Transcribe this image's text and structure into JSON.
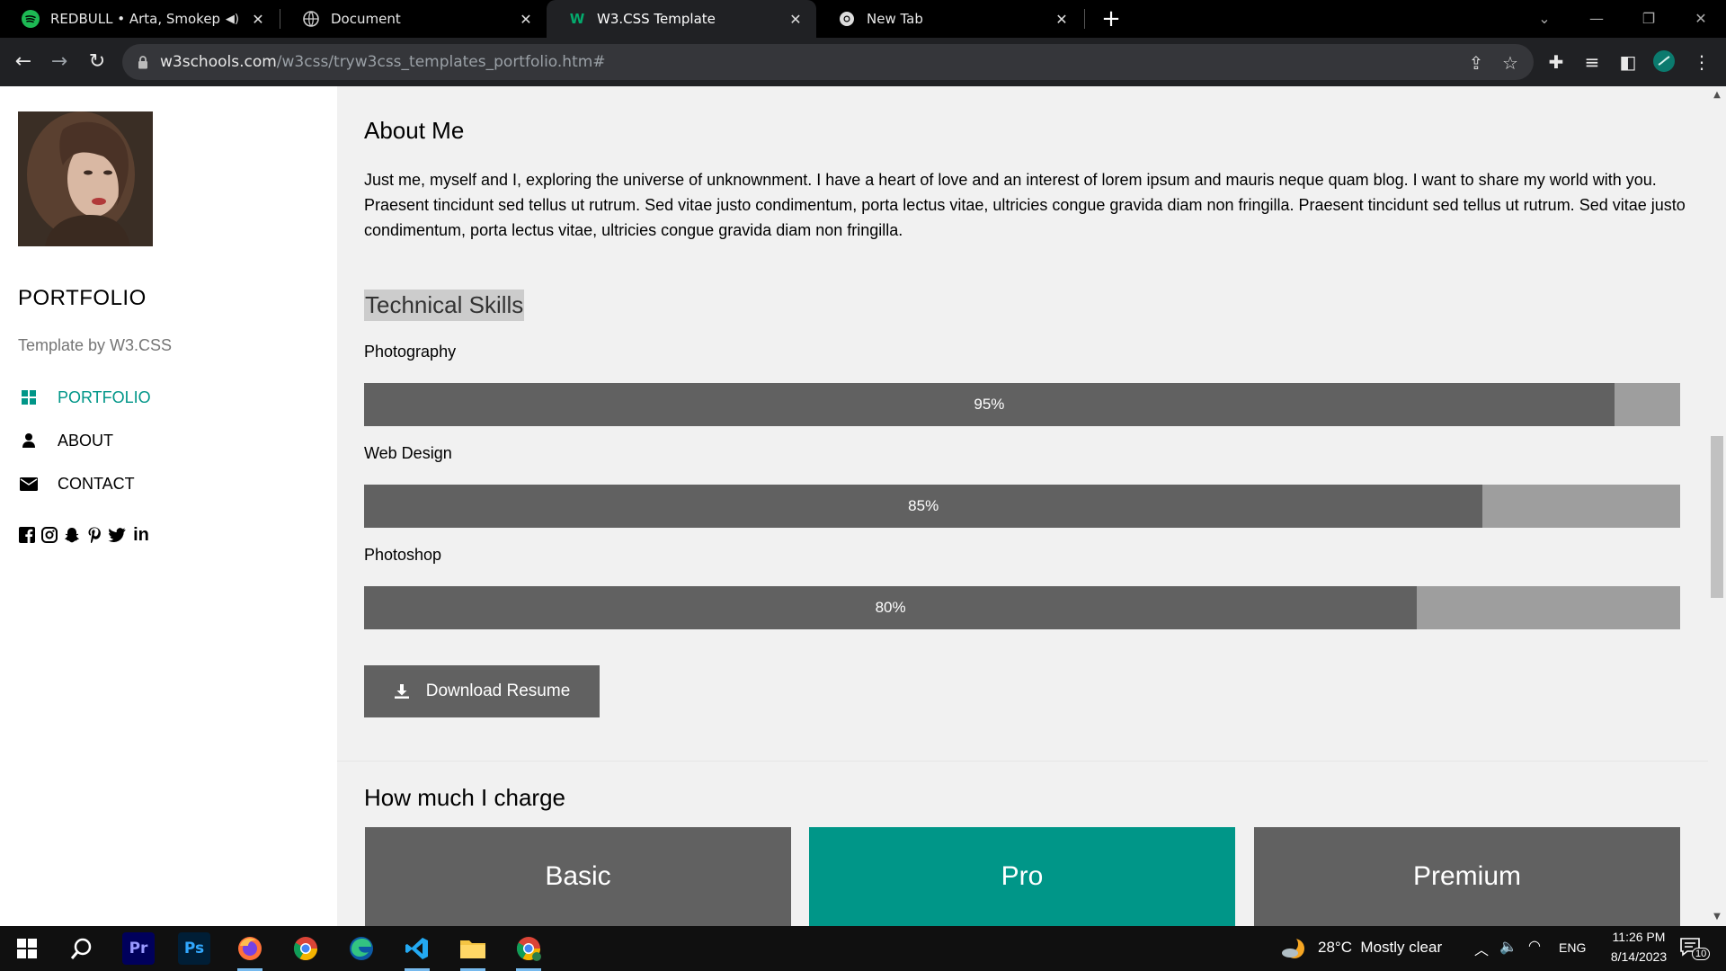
{
  "browser": {
    "tabs": [
      {
        "title": "REDBULL • Arta, Smokepurpp",
        "favicon": "spotify-icon",
        "audio": true
      },
      {
        "title": "Document",
        "favicon": "globe-icon"
      },
      {
        "title": "W3.CSS Template",
        "favicon": "w3schools-icon",
        "active": true
      },
      {
        "title": "New Tab",
        "favicon": "chrome-icon"
      }
    ],
    "url_host": "w3schools.com",
    "url_path": "/w3css/tryw3css_templates_portfolio.htm#"
  },
  "sidebar": {
    "brand": "PORTFOLIO",
    "byline": "Template by W3.CSS",
    "nav": [
      {
        "label": "PORTFOLIO",
        "icon": "grid-icon",
        "active": true
      },
      {
        "label": "ABOUT",
        "icon": "user-icon"
      },
      {
        "label": "CONTACT",
        "icon": "envelope-icon"
      }
    ],
    "social_icons": [
      "facebook-icon",
      "instagram-icon",
      "snapchat-icon",
      "pinterest-icon",
      "twitter-icon",
      "linkedin-icon"
    ],
    "colors": {
      "accent": "#009688"
    }
  },
  "main": {
    "about_heading": "About Me",
    "about_text": "Just me, myself and I, exploring the universe of unknownment. I have a heart of love and an interest of lorem ipsum and mauris neque quam blog. I want to share my world with you. Praesent tincidunt sed tellus ut rutrum. Sed vitae justo condimentum, porta lectus vitae, ultricies congue gravida diam non fringilla. Praesent tincidunt sed tellus ut rutrum. Sed vitae justo condimentum, porta lectus vitae, ultricies congue gravida diam non fringilla.",
    "skills_heading": "Technical Skills",
    "skills": [
      {
        "name": "Photography",
        "percent": 95,
        "label": "95%"
      },
      {
        "name": "Web Design",
        "percent": 85,
        "label": "85%"
      },
      {
        "name": "Photoshop",
        "percent": 80,
        "label": "80%"
      }
    ],
    "download_label": "Download Resume",
    "pricing_heading": "How much I charge",
    "plans": [
      {
        "name": "Basic",
        "color": "#616161"
      },
      {
        "name": "Pro",
        "color": "#009688"
      },
      {
        "name": "Premium",
        "color": "#616161"
      }
    ]
  },
  "taskbar": {
    "apps": [
      "windows-start-icon",
      "search-icon",
      "premiere-pro-icon",
      "photoshop-icon",
      "firefox-icon",
      "chrome-icon",
      "edge-icon",
      "vscode-icon",
      "file-explorer-icon",
      "chrome-profile-icon"
    ],
    "weather": "28°C  Mostly clear",
    "language": "ENG",
    "time": "11:26 PM",
    "date": "8/14/2023",
    "notifications": "10"
  }
}
